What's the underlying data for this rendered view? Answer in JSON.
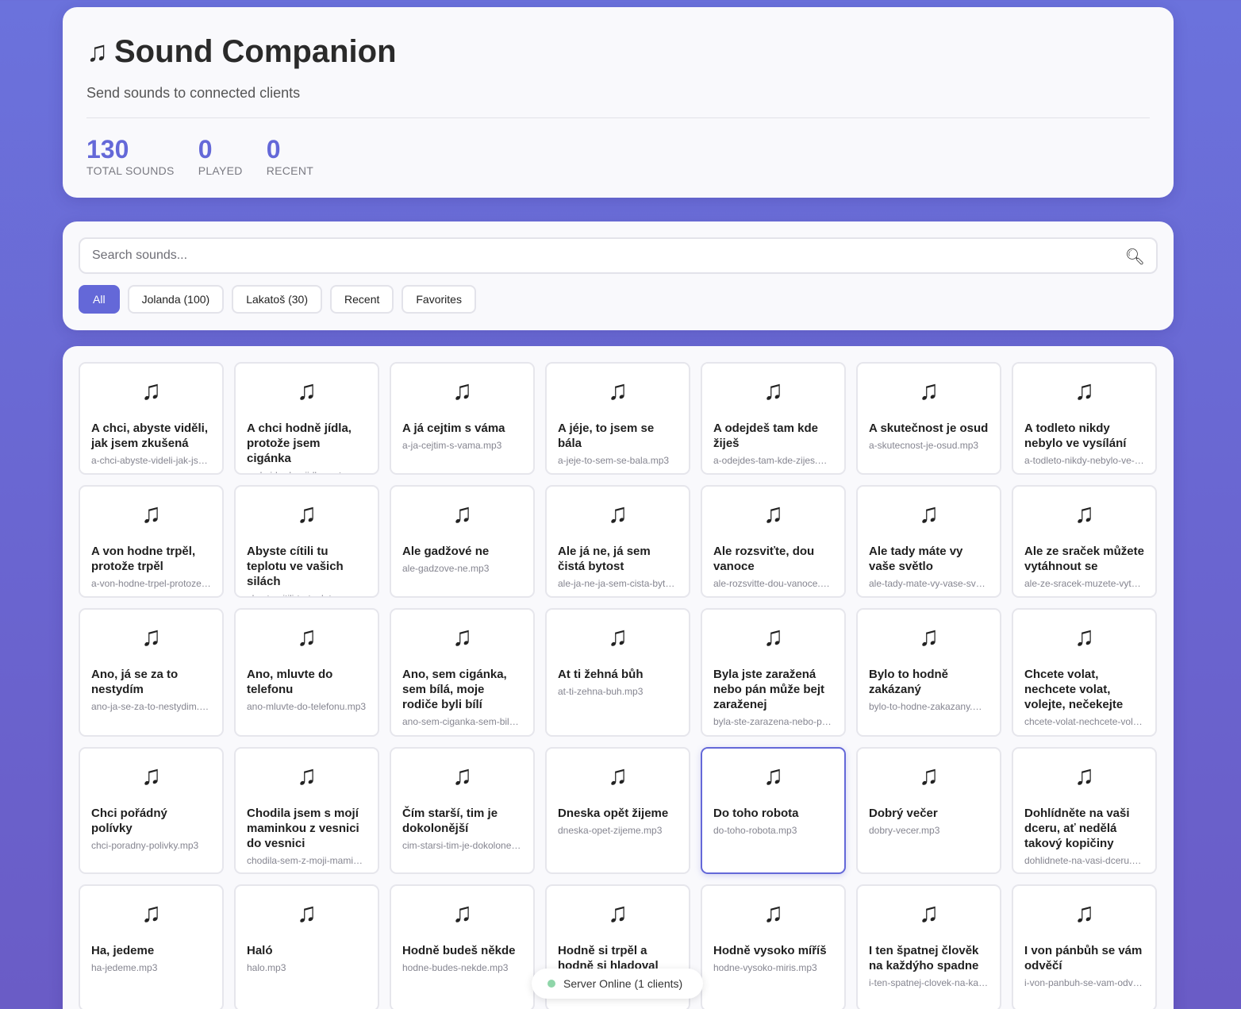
{
  "header": {
    "icon": "music-note-icon",
    "title": "Sound Companion",
    "subtitle": "Send sounds to connected clients",
    "stats": [
      {
        "value": "130",
        "label": "TOTAL SOUNDS"
      },
      {
        "value": "0",
        "label": "PLAYED"
      },
      {
        "value": "0",
        "label": "RECENT"
      }
    ]
  },
  "search": {
    "placeholder": "Search sounds...",
    "value": "",
    "icon": "search-icon"
  },
  "filters": [
    {
      "label": "All",
      "active": true
    },
    {
      "label": "Jolanda (100)",
      "active": false
    },
    {
      "label": "Lakatoš (30)",
      "active": false
    },
    {
      "label": "Recent",
      "active": false
    },
    {
      "label": "Favorites",
      "active": false
    }
  ],
  "accent_color": "#6468d8",
  "sounds": [
    {
      "name": "A chci, abyste viděli, jak jsem zkušená",
      "file": "a-chci-abyste-videli-jak-jsem-zkusena.mp3"
    },
    {
      "name": "A chci hodně jídla, protože jsem cigánka",
      "file": "a-chci-hodne-jidla-protoze-jsem-ciganka.mp3"
    },
    {
      "name": "A já cejtim s váma",
      "file": "a-ja-cejtim-s-vama.mp3"
    },
    {
      "name": "A jéje, to jsem se bála",
      "file": "a-jeje-to-sem-se-bala.mp3"
    },
    {
      "name": "A odejdeš tam kde žiješ",
      "file": "a-odejdes-tam-kde-zijes.mp3"
    },
    {
      "name": "A skutečnost je osud",
      "file": "a-skutecnost-je-osud.mp3"
    },
    {
      "name": "A todleto nikdy nebylo ve vysílání",
      "file": "a-todleto-nikdy-nebylo-ve-vysilani.mp3"
    },
    {
      "name": "A von hodne trpěl, protože trpěl",
      "file": "a-von-hodne-trpel-protoze-trpel.mp3"
    },
    {
      "name": "Abyste cítili tu teplotu ve vašich silách",
      "file": "abyste-citili-tu-teplotu-ve-vasich-silach.mp3"
    },
    {
      "name": "Ale gadžové ne",
      "file": "ale-gadzove-ne.mp3"
    },
    {
      "name": "Ale já ne, já sem čistá bytost",
      "file": "ale-ja-ne-ja-sem-cista-bytost.mp3"
    },
    {
      "name": "Ale rozsviťte, dou vanoce",
      "file": "ale-rozsvitte-dou-vanoce.mp3"
    },
    {
      "name": "Ale tady máte vy vaše světlo",
      "file": "ale-tady-mate-vy-vase-svetlo.mp3"
    },
    {
      "name": "Ale ze sraček můžete vytáhnout se",
      "file": "ale-ze-sracek-muzete-vytahnout-se.mp3"
    },
    {
      "name": "Ano, já se za to nestydím",
      "file": "ano-ja-se-za-to-nestydim.mp3"
    },
    {
      "name": "Ano, mluvte do telefonu",
      "file": "ano-mluvte-do-telefonu.mp3"
    },
    {
      "name": "Ano, sem cigánka, sem bílá, moje rodiče byli bílí",
      "file": "ano-sem-ciganka-sem-bila.mp3"
    },
    {
      "name": "At ti žehná bůh",
      "file": "at-ti-zehna-buh.mp3"
    },
    {
      "name": "Byla jste zaražená nebo pán může bejt zaraženej",
      "file": "byla-ste-zarazena-nebo-pan.mp3"
    },
    {
      "name": "Bylo to hodně zakázaný",
      "file": "bylo-to-hodne-zakazany.mp3"
    },
    {
      "name": "Chcete volat, nechcete volat, volejte, nečekejte",
      "file": "chcete-volat-nechcete-volat.mp3"
    },
    {
      "name": "Chci pořádný polívky",
      "file": "chci-poradny-polivky.mp3"
    },
    {
      "name": "Chodila jsem s mojí maminkou z vesnici do vesnici",
      "file": "chodila-sem-z-moji-maminkou.mp3"
    },
    {
      "name": "Čím starší, tim je dokolonější",
      "file": "cim-starsi-tim-je-dokolonejsi.mp3"
    },
    {
      "name": "Dneska opět žijeme",
      "file": "dneska-opet-zijeme.mp3"
    },
    {
      "name": "Do toho robota",
      "file": "do-toho-robota.mp3",
      "selected": true
    },
    {
      "name": "Dobrý večer",
      "file": "dobry-vecer.mp3"
    },
    {
      "name": "Dohlídněte na vaši dceru, ať nedělá takový kopičiny",
      "file": "dohlidnete-na-vasi-dceru.mp3"
    },
    {
      "name": "Ha, jedeme",
      "file": "ha-jedeme.mp3"
    },
    {
      "name": "Haló",
      "file": "halo.mp3"
    },
    {
      "name": "Hodně budeš někde",
      "file": "hodne-budes-nekde.mp3"
    },
    {
      "name": "Hodně si trpěl a hodně si hladoval",
      "file": "hodne-si-trpel-a-hodne-si-hladoval.mp3"
    },
    {
      "name": "Hodně vysoko míříš",
      "file": "hodne-vysoko-miris.mp3"
    },
    {
      "name": "I ten špatnej člověk na každýho spadne",
      "file": "i-ten-spatnej-clovek-na-kazdyho.mp3"
    },
    {
      "name": "I von pánbůh se vám odvěčí",
      "file": "i-von-panbuh-se-vam-odveci.mp3"
    }
  ],
  "status": {
    "text": "Server Online (1 clients)",
    "color": "#8fd6a9"
  }
}
